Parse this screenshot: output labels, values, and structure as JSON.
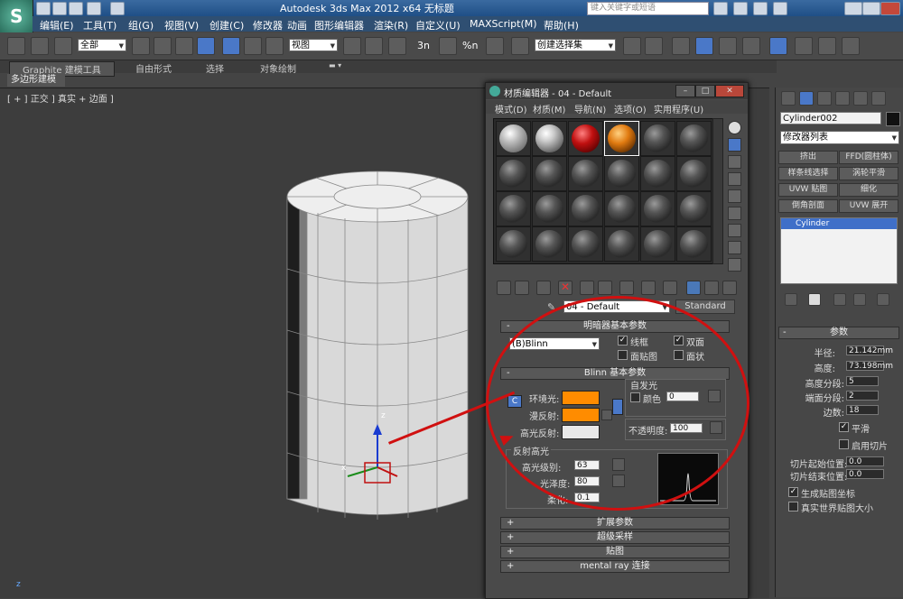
{
  "app": {
    "title": "Autodesk 3ds Max  2012 x64     无标题",
    "logo": "S",
    "search_placeholder": "键入关键字或短语",
    "menu": [
      "编辑(E)",
      "工具(T)",
      "组(G)",
      "视图(V)",
      "创建(C)",
      "修改器",
      "动画",
      "图形编辑器",
      "渲染(R)",
      "自定义(U)",
      "MAXScript(M)",
      "帮助(H)"
    ]
  },
  "toolbar": {
    "selection_filter": "全部",
    "ref_coord": "视图",
    "snap_labels": [
      "3n",
      "%n"
    ],
    "named_selection": "创建选择集"
  },
  "ribbon": {
    "tabs": [
      "Graphite 建模工具",
      "自由形式",
      "选择",
      "对象绘制"
    ],
    "active_tab": "Graphite 建模工具",
    "sub_tab": "多边形建模"
  },
  "viewport": {
    "label": "[ + ] 正交 ] 真实 + 边面 ]",
    "axis_z": "z",
    "axis_x": "x",
    "corner_axis": "z"
  },
  "material_editor": {
    "title": "材质编辑器 - 04 - Default",
    "menu": [
      "模式(D)",
      "材质(M)",
      "导航(N)",
      "选项(O)",
      "实用程序(U)"
    ],
    "material_name": "04 - Default",
    "material_type": "Standard",
    "shader_rollout": {
      "header": "明暗器基本参数",
      "shader": "(B)Blinn",
      "options": [
        {
          "label": "线框",
          "checked": true
        },
        {
          "label": "双面",
          "checked": true
        },
        {
          "label": "面贴图",
          "checked": false
        },
        {
          "label": "面状",
          "checked": false
        }
      ]
    },
    "blinn_rollout": {
      "header": "Blinn 基本参数",
      "self_illum_label": "自发光",
      "color_label": "颜色",
      "color_value": "0",
      "ambient_label": "环境光:",
      "diffuse_label": "漫反射:",
      "specular_label": "高光反射:",
      "ambient_color": "#ff8c00",
      "diffuse_color": "#ff8c00",
      "specular_color": "#e8e8e8",
      "opacity_label": "不透明度:",
      "opacity_value": "100",
      "lock_letter": "C"
    },
    "specular_group": {
      "header": "反射高光",
      "level_label": "高光级别:",
      "level_value": "63",
      "gloss_label": "光泽度:",
      "gloss_value": "80",
      "soften_label": "柔化:",
      "soften_value": "0.1"
    },
    "collapsed_rollouts": [
      "扩展参数",
      "超级采样",
      "贴图",
      "mental ray 连接"
    ],
    "plus": "+",
    "minus": "-"
  },
  "command_panel": {
    "object_name": "Cylinder002",
    "modifier_list": "修改器列表",
    "modifier_buttons": [
      "挤出",
      "FFD(圆柱体)",
      "样条线选择",
      "涡轮平滑",
      "UVW 贴图",
      "细化",
      "倒角剖面",
      "UVW 展开"
    ],
    "stack_item": "Cylinder",
    "params_header": "参数",
    "params": [
      {
        "label": "半径:",
        "value": "21.142mm"
      },
      {
        "label": "高度:",
        "value": "73.198mm"
      },
      {
        "label": "高度分段:",
        "value": "5"
      },
      {
        "label": "端面分段:",
        "value": "2"
      },
      {
        "label": "边数:",
        "value": "18"
      }
    ],
    "smooth_label": "平滑",
    "smooth_checked": true,
    "slice_label": "启用切片",
    "slice_from_label": "切片起始位置:",
    "slice_from_value": "0.0",
    "slice_to_label": "切片结束位置:",
    "slice_to_value": "0.0",
    "gen_map_label": "生成贴图坐标",
    "gen_map_checked": true,
    "real_world_label": "真实世界贴图大小",
    "real_world_checked": false
  },
  "colors": {
    "accent_red": "#d01010",
    "orange": "#ff8c00",
    "selection_blue": "#4a78c8"
  }
}
